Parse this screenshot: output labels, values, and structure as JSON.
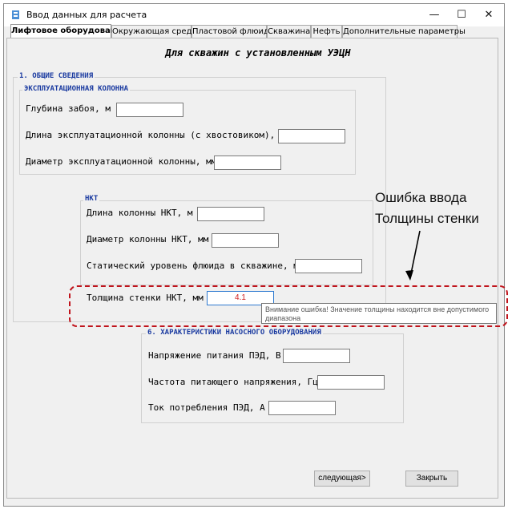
{
  "window": {
    "title": "Ввод данных для расчета",
    "minimize": "—",
    "maximize": "☐",
    "close": "✕"
  },
  "tabs": [
    {
      "label": "Лифтовое оборудование",
      "active": true
    },
    {
      "label": "Окружающая среда",
      "active": false
    },
    {
      "label": "Пластовой флюид",
      "active": false
    },
    {
      "label": "Скважина",
      "active": false
    },
    {
      "label": "Нефть",
      "active": false
    },
    {
      "label": "Дополнительные параметры",
      "active": false
    }
  ],
  "heading": "Для скважин с установленным УЭЦН",
  "general": {
    "title": "1. ОБЩИЕ СВЕДЕНИЯ",
    "casing_title": "ЭКСПЛУАТАЦИОННАЯ КОЛОННА",
    "fields": [
      {
        "label": "Глубина забоя, м",
        "value": ""
      },
      {
        "label": "Длина эксплуатационной колонны (с хвостовиком), м",
        "value": ""
      },
      {
        "label": "Диаметр эксплуатационной колонны, мм",
        "value": ""
      }
    ]
  },
  "nkt": {
    "title": "НКТ",
    "fields": [
      {
        "label": "Длина колонны НКТ, м",
        "value": ""
      },
      {
        "label": "Диаметр колонны НКТ, мм",
        "value": ""
      },
      {
        "label": "Статический уровень флюида в скважине, м",
        "value": ""
      },
      {
        "label": "Толщина стенки НКТ, мм",
        "value": "4.1"
      }
    ]
  },
  "tooltip": {
    "line1": "Внимание ошибка! Значение толщины находится вне допустимого",
    "line2": "диапазона"
  },
  "pump": {
    "title": "6. ХАРАКТЕРИСТИКИ НАСОСНОГО ОБОРУДОВАНИЯ",
    "fields": [
      {
        "label": "Напряжение питания ПЭД, В",
        "value": ""
      },
      {
        "label": "Частота питающего напряжения, Гц",
        "value": ""
      },
      {
        "label": "Ток потребления ПЭД, А",
        "value": ""
      }
    ]
  },
  "annotation": {
    "line1": "Ошибка ввода",
    "line2": "Толщины стенки"
  },
  "buttons": {
    "next": "следующая>",
    "close": "Закрыть"
  },
  "colors": {
    "error_outline": "#c0141c",
    "group_title": "#1a3aa0",
    "error_text": "#d02020"
  }
}
